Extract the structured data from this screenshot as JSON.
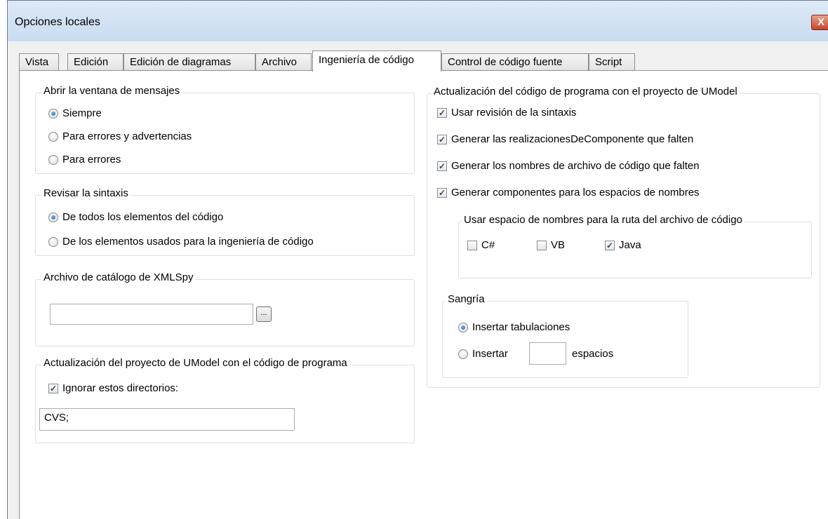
{
  "window": {
    "title": "Opciones locales",
    "close_glyph": "X"
  },
  "tabs": [
    {
      "label": "Vista"
    },
    {
      "label": "Edición"
    },
    {
      "label": "Edición de diagramas"
    },
    {
      "label": "Archivo"
    },
    {
      "label": "Ingeniería de código"
    },
    {
      "label": "Control de código fuente"
    },
    {
      "label": "Script"
    }
  ],
  "active_tab": "Ingeniería de código",
  "messages_group": {
    "legend": "Abrir la ventana de mensajes",
    "options": [
      {
        "label": "Siempre",
        "selected": true
      },
      {
        "label": "Para errores y advertencias",
        "selected": false
      },
      {
        "label": "Para errores",
        "selected": false
      }
    ]
  },
  "syntax_group": {
    "legend": "Revisar la sintaxis",
    "options": [
      {
        "label": "De todos los elementos del código",
        "selected": true
      },
      {
        "label": "De los elementos usados para la ingeniería de código",
        "selected": false
      }
    ]
  },
  "catalog_group": {
    "legend": "Archivo de catálogo de XMLSpy",
    "value": "",
    "browse_label": "..."
  },
  "update_model_group": {
    "legend": "Actualización del proyecto de UModel con el código de programa",
    "ignore_label": "Ignorar estos directorios:",
    "ignore_checked": true,
    "dirs_value": "CVS;"
  },
  "update_code_group": {
    "legend": "Actualización del código de programa con el proyecto de UModel",
    "checks": [
      {
        "label": "Usar revisión de la sintaxis",
        "checked": true
      },
      {
        "label": "Generar las realizacionesDeComponente que falten",
        "checked": true
      },
      {
        "label": "Generar los nombres de archivo de código que falten",
        "checked": true
      },
      {
        "label": "Generar componentes para los espacios de nombres",
        "checked": true
      }
    ],
    "namespace_group": {
      "legend": "Usar espacio de nombres para la ruta del archivo de código",
      "langs": [
        {
          "label": "C#",
          "checked": false
        },
        {
          "label": "VB",
          "checked": false
        },
        {
          "label": "Java",
          "checked": true
        }
      ]
    },
    "indent_group": {
      "legend": "Sangría",
      "tabs_label": "Insertar tabulaciones",
      "tabs_selected": true,
      "insert_label": "Insertar",
      "insert_selected": false,
      "spaces_value": "",
      "spaces_label": "espacios"
    }
  },
  "colors": {
    "group_border": "#d5dfe5",
    "titlebar": "#c8dcf1",
    "check_mark": "#23466a"
  }
}
